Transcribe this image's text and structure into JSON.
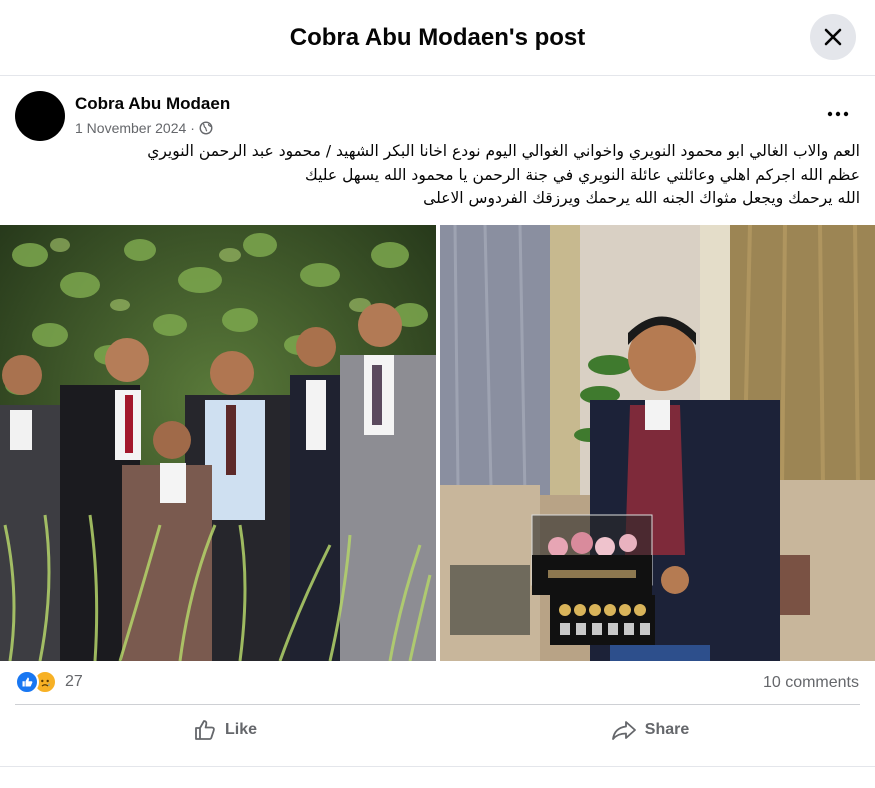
{
  "header": {
    "title": "Cobra Abu Modaen's post",
    "close_icon": "close-icon"
  },
  "post": {
    "author": "Cobra Abu Modaen",
    "date": "1 November 2024",
    "separator": "·",
    "privacy_icon": "globe-icon",
    "more_icon": "more-dots-icon",
    "text_lines": [
      "العم والاب  الغالي ابو محمود النويري واخواني الغوالي اليوم نودع اخانا البكر الشهيد / محمود عبد الرحمن النويري",
      "عظم الله اجركم اهلي وعائلتي  عائلة النويري في جنة الرحمن يا محمود الله يسهل عليك",
      "الله يرحمك ويجعل مثواك الجنه الله يرحمك ويرزقك الفردوس الاعلى"
    ]
  },
  "stats": {
    "reaction_icons": [
      "like-icon",
      "sad-icon"
    ],
    "reaction_count": "27",
    "comments": "10 comments"
  },
  "actions": {
    "like_label": "Like",
    "share_label": "Share"
  },
  "colors": {
    "accent": "#1877f2",
    "secondary_text": "#65676b",
    "divider": "#ced0d4"
  }
}
